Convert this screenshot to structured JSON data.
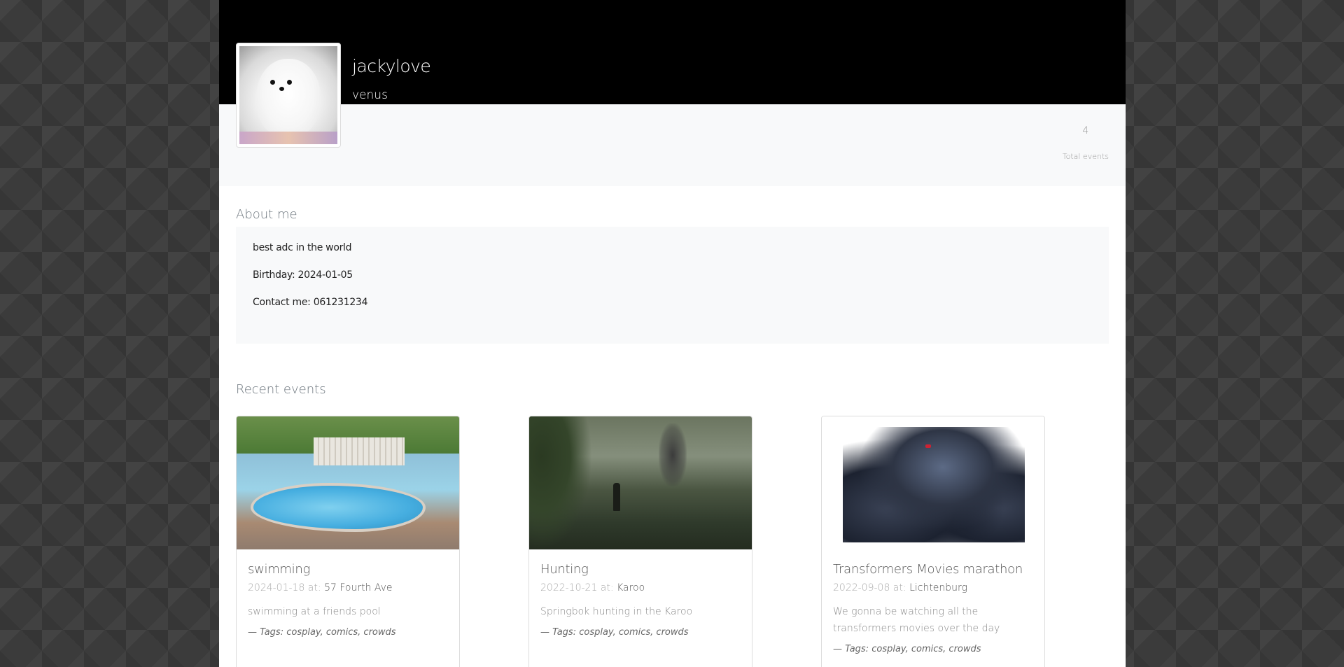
{
  "profile": {
    "username": "jackylove",
    "location": "venus",
    "avatar_alt": "white fluffy dog",
    "stats": {
      "total_events_value": "4",
      "total_events_label": "Total events"
    }
  },
  "about": {
    "heading": "About me",
    "bio": "best adc in the world",
    "birthday": "Birthday: 2024-01-05",
    "contact": "Contact me: 061231234"
  },
  "events": {
    "heading": "Recent events",
    "items": [
      {
        "title": "swimming",
        "date": "2024-01-18 at:",
        "place": "57 Fourth Ave",
        "description": "swimming at a friends pool",
        "tags": "— Tags: cosplay, comics, crowds"
      },
      {
        "title": "Hunting",
        "date": "2022-10-21 at:",
        "place": "Karoo",
        "description": "Springbok hunting in the Karoo",
        "tags": "— Tags: cosplay, comics, crowds"
      },
      {
        "title": "Transformers Movies marathon",
        "date": "2022-09-08 at:",
        "place": "Lichtenburg",
        "description": "We gonna be watching all the transformers movies over the day",
        "tags": "— Tags: cosplay, comics, crowds"
      }
    ]
  }
}
